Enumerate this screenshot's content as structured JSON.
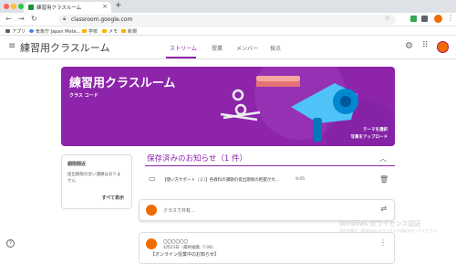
{
  "browser": {
    "tab_title": "練習用クラスルーム",
    "url": "classroom.google.com",
    "new_tab": "+",
    "tab_close": "×",
    "bookmarks": [
      "アプリ",
      "気象庁 Japan Mete...",
      "学校",
      "メモ",
      "新規"
    ]
  },
  "header": {
    "class_name": "練習用クラスルーム",
    "tabs": [
      "ストリーム",
      "授業",
      "メンバー",
      "採点"
    ],
    "active_tab": "ストリーム"
  },
  "banner": {
    "title": "練習用クラスルーム",
    "code_label": "クラス コード",
    "select_theme": "テーマを選択",
    "upload_photo": "写真をアップロード",
    "color": "#8e24aa"
  },
  "due_card": {
    "title": "期限間近",
    "body": "提出期限の近い課題はありません",
    "link": "すべて表示"
  },
  "saved": {
    "title": "保存済みのお知らせ（1 件）",
    "notice_text": "【使い方サポート（２）】各教科の課題の提出期限の把握が大...",
    "notice_time": "9:05"
  },
  "share": {
    "placeholder": "クラスで共有..."
  },
  "post": {
    "author": "〇〇〇〇〇〇",
    "date": "4月23日（最終編集: 7:08）",
    "body": "【オンライン授業中のお知らせ】"
  },
  "help": "?",
  "watermark": {
    "line1": "Windows のライセンス認証",
    "line2": "設定を開き、Windows のライセンス認証を行ってください。"
  }
}
